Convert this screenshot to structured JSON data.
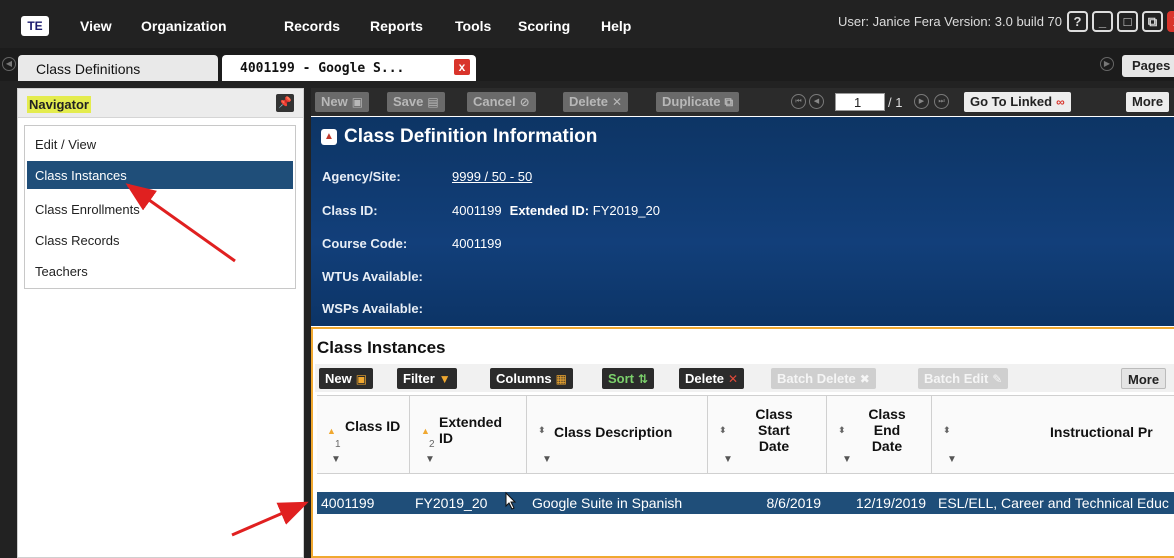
{
  "app": {
    "logo": "TE",
    "menu": [
      "View",
      "Organization",
      "Records",
      "Reports",
      "Tools",
      "Scoring",
      "Help"
    ],
    "user_info": "User: Janice Fera   Version: 3.0 build 70",
    "window_buttons": {
      "help": "?",
      "minimize": "_",
      "restore": "□",
      "max": "⧉",
      "close": "X"
    }
  },
  "tabs": [
    {
      "label": "Class Definitions"
    },
    {
      "label": "4001199 - Google S..."
    }
  ],
  "tab_close": "x",
  "pages_label": "Pages",
  "navigator": {
    "title": "Navigator",
    "items": [
      "Edit / View",
      "Class Instances",
      "Class Enrollments",
      "Class Records",
      "Teachers"
    ],
    "selected_index": 1
  },
  "toolbar": {
    "new": "New",
    "save": "Save",
    "cancel": "Cancel",
    "delete": "Delete",
    "duplicate": "Duplicate",
    "page_value": "1",
    "page_total": "/ 1",
    "go_to_linked": "Go To Linked",
    "more": "More"
  },
  "info": {
    "title": "Class Definition Information",
    "fields": {
      "agency_label": "Agency/Site:",
      "agency_value": "9999 / 50 - 50",
      "class_id_label": "Class ID:",
      "class_id_value": "4001199",
      "extended_id_label": "Extended ID:",
      "extended_id_value": "FY2019_20",
      "course_code_label": "Course Code:",
      "course_code_value": "4001199",
      "wtus_label": "WTUs Available:",
      "wsps_label": "WSPs Available:"
    }
  },
  "instances": {
    "title": "Class Instances",
    "toolbar": {
      "new": "New",
      "filter": "Filter",
      "columns": "Columns",
      "sort": "Sort",
      "delete": "Delete",
      "batch_delete": "Batch Delete",
      "batch_edit": "Batch Edit",
      "more": "More"
    },
    "columns": {
      "class_id": "Class ID",
      "extended_id": "Extended ID",
      "class_description": "Class Description",
      "class_start_date": "Class Start Date",
      "class_end_date": "Class End Date",
      "instructional_program": "Instructional Pr"
    },
    "sort_orders": {
      "class_id": "1",
      "extended_id": "2"
    },
    "rows": [
      {
        "class_id": "4001199",
        "extended_id": "FY2019_20",
        "class_description": "Google Suite in Spanish",
        "class_start_date": "8/6/2019",
        "class_end_date": "12/19/2019",
        "instructional_program": "ESL/ELL, Career and Technical Educ"
      }
    ]
  },
  "annotation_color": "#e02020",
  "accent_colors": {
    "menubar": "#222222",
    "selection": "#1f4e79",
    "banner": "#123f7a",
    "section_border": "#f0a830",
    "highlight": "#e4ec4e"
  }
}
